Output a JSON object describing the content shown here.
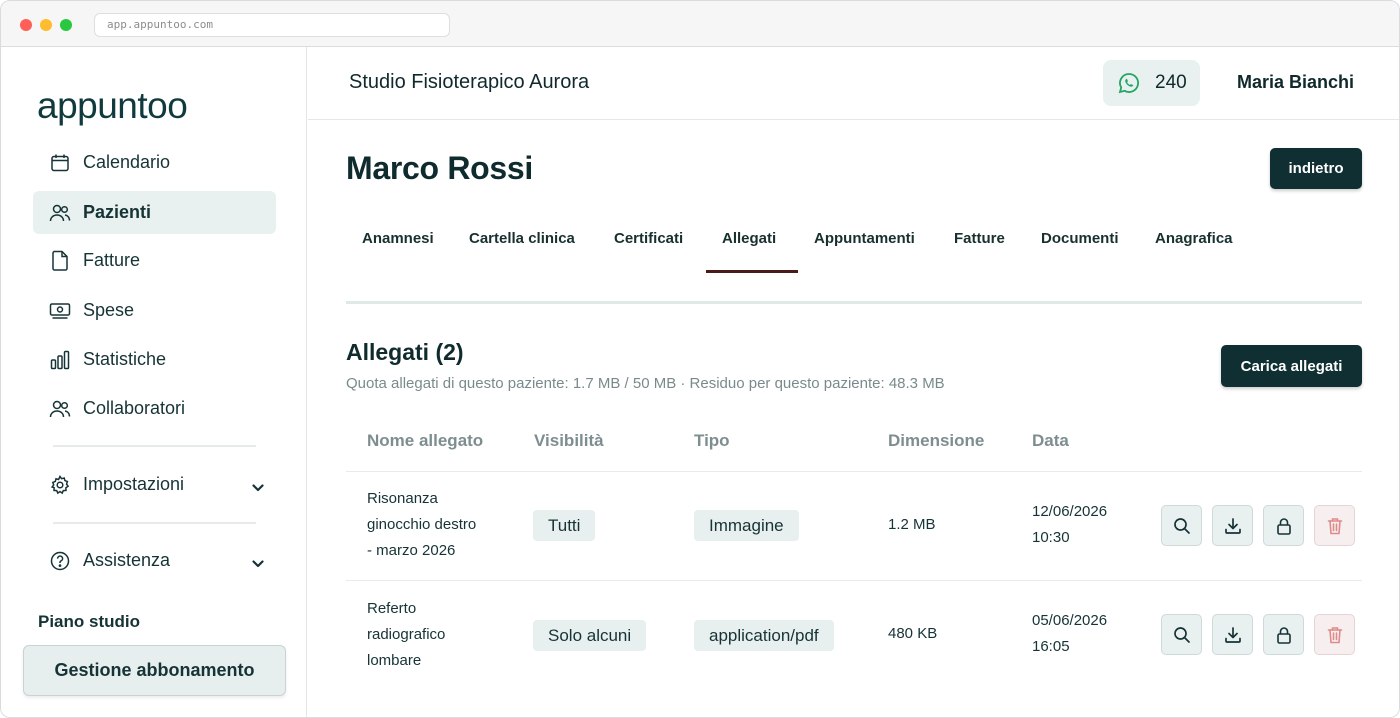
{
  "browser": {
    "url": "app.appuntoo.com"
  },
  "sidebar": {
    "logo": "appuntoo",
    "items": [
      {
        "label": "Calendario",
        "icon": "calendar-icon"
      },
      {
        "label": "Pazienti",
        "icon": "users-icon",
        "active": true
      },
      {
        "label": "Fatture",
        "icon": "document-icon"
      },
      {
        "label": "Spese",
        "icon": "money-icon"
      },
      {
        "label": "Statistiche",
        "icon": "bar-chart-icon"
      },
      {
        "label": "Collaboratori",
        "icon": "users-icon"
      },
      {
        "label": "Impostazioni",
        "icon": "gear-icon"
      },
      {
        "label": "Assistenza",
        "icon": "help-circle-icon"
      }
    ],
    "plan_label": "Piano studio",
    "plan_button": "Gestione abbonamento"
  },
  "header": {
    "studio_name": "Studio Fisioterapico Aurora",
    "whatsapp_count": "240",
    "user_name": "Maria Bianchi"
  },
  "patient": {
    "name": "Marco Rossi",
    "back_label": "indietro"
  },
  "tabs": [
    "Anamnesi",
    "Cartella clinica",
    "Certificati",
    "Allegati",
    "Appuntamenti",
    "Fatture",
    "Documenti",
    "Anagrafica"
  ],
  "active_tab": "Allegati",
  "attachments": {
    "title": "Allegati (2)",
    "quota": "Quota allegati di questo paziente: 1.7 MB / 50 MB · Residuo per questo paziente: 48.3 MB",
    "upload_label": "Carica allegati",
    "columns": [
      "Nome allegato",
      "Visibilità",
      "Tipo",
      "Dimensione",
      "Data"
    ],
    "rows": [
      {
        "name_lines": [
          "Risonanza",
          "ginocchio destro",
          "- marzo 2026"
        ],
        "visibility": "Tutti",
        "type": "Immagine",
        "size": "1.2 MB",
        "date": "12/06/2026",
        "time": "10:30"
      },
      {
        "name_lines": [
          "Referto",
          "radiografico",
          "lombare"
        ],
        "visibility": "Solo alcuni",
        "type": "application/pdf",
        "size": "480 KB",
        "date": "05/06/2026",
        "time": "16:05"
      }
    ]
  },
  "colors": {
    "primary_dark": "#0f2f33",
    "active_tab_underline": "#4a1a1a",
    "chip_bg": "#e8efef",
    "delete_icon": "#e08a8a",
    "whatsapp": "#25a563"
  }
}
